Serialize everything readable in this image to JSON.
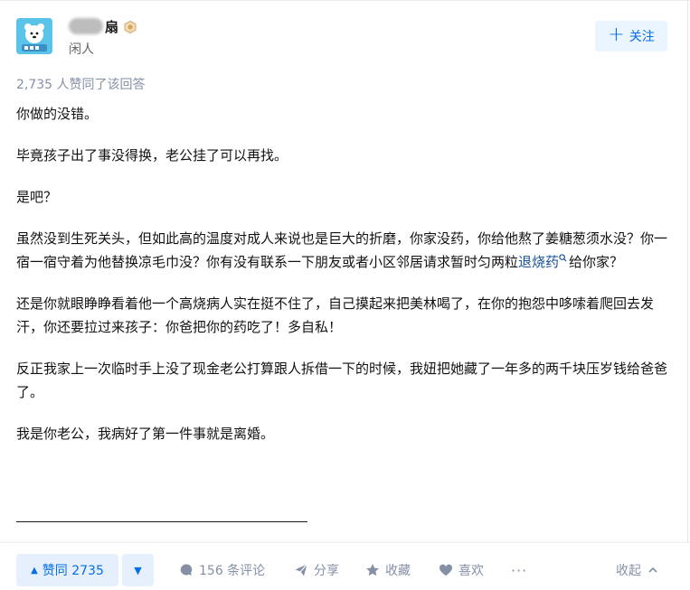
{
  "author": {
    "name_visible": "扇",
    "description": "闲人"
  },
  "follow_button": {
    "label": "关注"
  },
  "vote_summary": "2,735 人赞同了该回答",
  "content": {
    "paragraphs": [
      "你做的没错。",
      "毕竟孩子出了事没得换，老公挂了可以再找。",
      "是吧？",
      "虽然没到生死关头，但如此高的温度对成人来说也是巨大的折磨，你家没药，你给他熬了姜糖葱须水没？你一宿一宿守着为他替换凉毛巾没？你有没有联系一下朋友或者小区邻居请求暂时匀两粒",
      "给你家？",
      "还是你就眼睁睁看着他一个高烧病人实在挺不住了，自己摸起来把美林喝了，在你的抱怨中哆嗦着爬回去发汗，你还要拉过来孩子：你爸把你的药吃了！多自私！",
      "反正我家上一次临时手上没了现金老公打算跟人拆借一下的时候，我妞把她藏了一年多的两千块压岁钱给爸爸了。",
      "我是你老公，我病好了第一件事就是离婚。"
    ],
    "search_link_text": "退烧药"
  },
  "actions": {
    "upvote_label": "赞同 2735",
    "comment_label": "156 条评论",
    "share_label": "分享",
    "favorite_label": "收藏",
    "like_label": "喜欢",
    "more_label": "···",
    "collapse_label": "收起"
  },
  "colors": {
    "accent": "#056de8",
    "accent_bg": "#e5f0fc",
    "muted": "#8590a6",
    "link": "#175199"
  }
}
